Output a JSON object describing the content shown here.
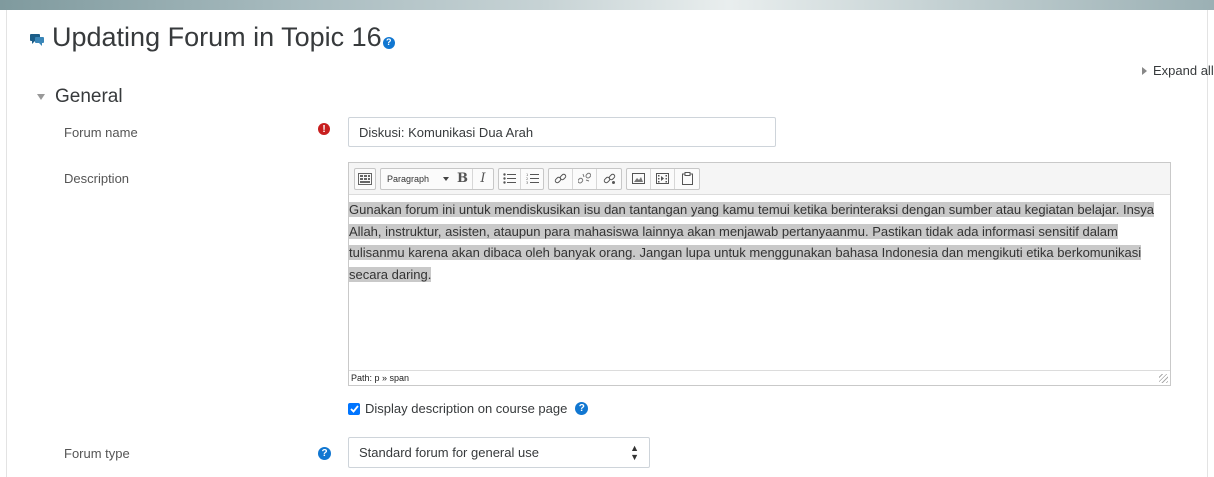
{
  "page": {
    "title": "Updating Forum in Topic 16",
    "title_icon": "forum-icon",
    "help_icon": "question-circle-icon"
  },
  "expand_all": "Expand all",
  "section": {
    "label": "General"
  },
  "fields": {
    "forum_name": {
      "label": "Forum name",
      "value": "Diskusi: Komunikasi Dua Arah",
      "required_icon": "exclamation-circle-icon"
    },
    "description": {
      "label": "Description",
      "format_label": "Paragraph",
      "content": "Gunakan forum ini untuk mendiskusikan isu dan tantangan yang kamu temui ketika berinteraksi dengan sumber atau kegiatan belajar. Insya Allah, instruktur, asisten, ataupun para mahasiswa lainnya akan menjawab pertanyaanmu. Pastikan tidak ada informasi sensitif dalam tulisanmu karena akan dibaca oleh banyak orang. Jangan lupa untuk menggunakan bahasa Indonesia dan mengikuti etika berkomunikasi secara daring.",
      "path": "Path: p » span",
      "toolbar_icons": [
        "toolbar-toggle-icon",
        "bold-icon",
        "italic-icon",
        "unordered-list-icon",
        "ordered-list-icon",
        "link-icon",
        "unlink-icon",
        "autolink-icon",
        "image-icon",
        "media-icon",
        "manage-files-icon"
      ]
    },
    "display_description": {
      "label": "Display description on course page",
      "checked": true
    },
    "forum_type": {
      "label": "Forum type",
      "value": "Standard forum for general use"
    }
  },
  "colors": {
    "help_blue": "#1177d1",
    "required_red": "#c81e1e",
    "checkbox_blue": "#0075ff",
    "selection_gray": "#c9c9c9"
  }
}
